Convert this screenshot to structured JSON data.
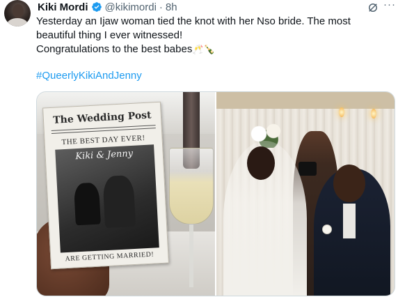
{
  "tweet": {
    "author_name": "Kiki Mordi",
    "handle": "@kikimordi",
    "separator": "·",
    "time": "8h",
    "text_line1": "Yesterday an Ijaw woman tied the knot with her Nso bride. The most beautiful thing I ever witnessed!",
    "text_line2": "Congratulations to the best babes",
    "text_emojis": "🥂🍾",
    "hashtag": "#QueerlyKikiAndJenny",
    "more_label": "···"
  },
  "program": {
    "masthead": "The Wedding Post",
    "headline": "THE BEST DAY EVER!",
    "names": "Kiki & Jenny",
    "footer": "ARE GETTING MARRIED!"
  },
  "icons": {
    "verified": "verified-badge-icon",
    "grok": "grok-icon",
    "more": "more-options-icon"
  },
  "colors": {
    "text": "#0f1419",
    "secondary": "#536471",
    "link": "#1d9bf0",
    "verified": "#1d9bf0",
    "border": "#cfd9de"
  }
}
